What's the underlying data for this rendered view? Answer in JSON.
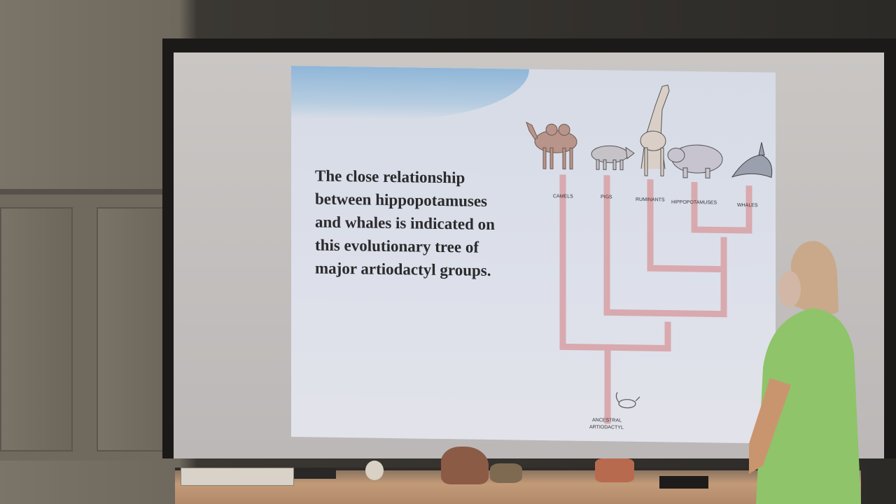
{
  "slide": {
    "text_lines": [
      "The close relationship",
      "between hippopotamuses",
      "and whales is indicated on",
      "this evolutionary tree of",
      "major artiodactyl groups."
    ]
  },
  "tree": {
    "labels": [
      "CAMELS",
      "PIGS",
      "RUMINANTS",
      "HIPPOPOTAMUSES",
      "WHALES"
    ],
    "root_label_line1": "ANCESTRAL",
    "root_label_line2": "ARTIODACTYL",
    "branch_color": "#d8a9ae"
  },
  "animals": [
    "camel-icon",
    "pig-icon",
    "giraffe-icon",
    "hippo-icon",
    "whale-icon",
    "ancestor-icon"
  ],
  "colors": {
    "slide_bg": "#dde0ea",
    "slide_band": "#8fb6d8",
    "shirt": "#8fc46a"
  }
}
